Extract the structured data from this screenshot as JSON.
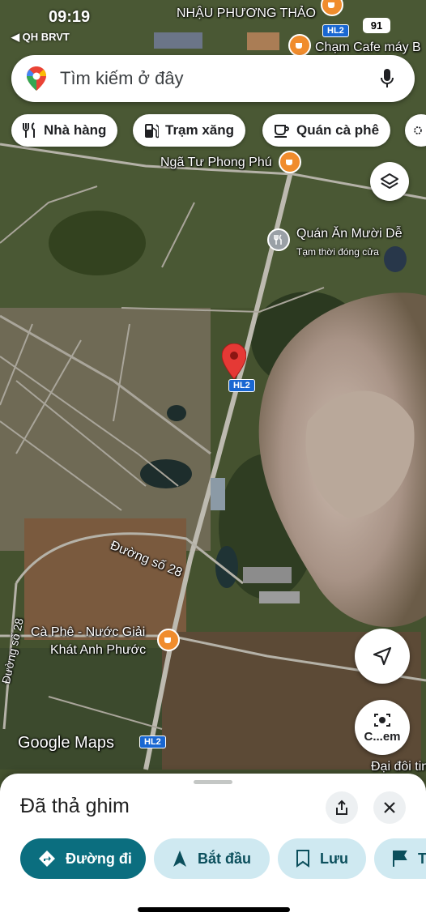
{
  "status": {
    "time": "09:19",
    "back_label": "◀ QH BRVT",
    "battery": "91"
  },
  "search": {
    "placeholder": "Tìm kiếm ở đây"
  },
  "chips": [
    {
      "label": "Nhà hàng",
      "icon": "fork-knife-icon"
    },
    {
      "label": "Trạm xăng",
      "icon": "gas-station-icon"
    },
    {
      "label": "Quán cà phê",
      "icon": "coffee-cup-icon"
    }
  ],
  "map": {
    "labels": {
      "top_place": "NHẬU PHƯƠNG THẢO",
      "top_cafe": "Chạm Cafe máy B",
      "junction": "Ngã Tư Phong Phú",
      "restaurant": "Quán Ăn Mười Dễ",
      "restaurant_status": "Tạm thời đóng cửa",
      "street_28_a": "Đường số 28",
      "street_28_b": "Đường số 28",
      "cafe_line1": "Cà Phê - Nước Giải",
      "cafe_line2": "Khát Anh Phước",
      "university": "Đại đôi tin",
      "route_top": "HL2",
      "route_pin": "HL2",
      "route_bottom": "HL2"
    },
    "watermark": "Google Maps",
    "camera_label": "C...em"
  },
  "sheet": {
    "title": "Đã thả ghim",
    "actions": [
      {
        "label": "Đường đi",
        "icon": "directions-icon"
      },
      {
        "label": "Bắt đầu",
        "icon": "navigation-arrow-icon"
      },
      {
        "label": "Lưu",
        "icon": "bookmark-icon"
      },
      {
        "label": "T",
        "icon": "flag-icon"
      }
    ]
  },
  "colors": {
    "pin": "#e53935",
    "cafe_poi": "#f08c2d",
    "primary_action": "#0b6e7f",
    "secondary_action": "#cfe9f1",
    "route_shield": "#1967d2"
  }
}
